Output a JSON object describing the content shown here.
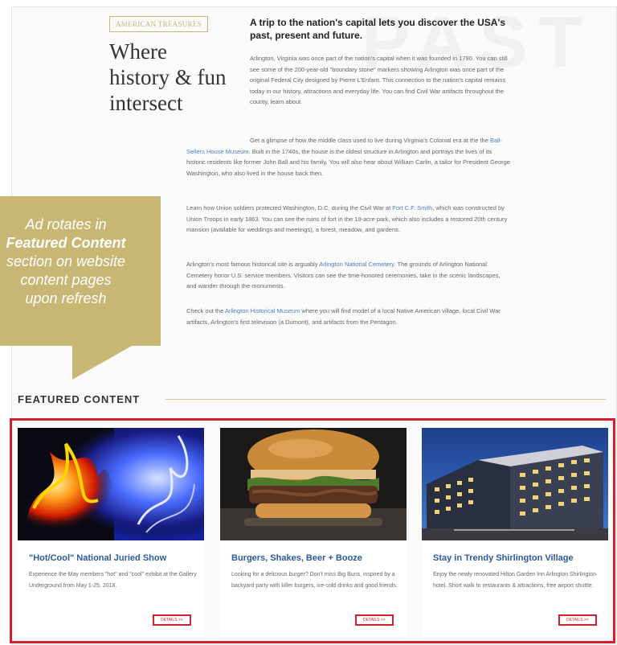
{
  "article": {
    "badge": "AMERICAN TREASURES",
    "headline": "Where history & fun intersect",
    "watermark": "PAST",
    "title": "A trip to the nation's capital lets you discover the USA's past, present and future.",
    "p1": "Arlington, Virginia was once part of the nation's capital when it was founded in 1790. You can still see some of the 200-year-old \"boundary stone\" markers showing Arlington was once part of the original Federal City designed by Pierre L'Enfant. This connection to the nation's capital remains today in our history, attractions and everyday life. You can find Civil War artifacts throughout the county, learn about",
    "p2_before": "Get a glimpse of how the middle class used to live during Virginia's Colonial era at the the ",
    "p2_link": "Ball-Sellers House Museum",
    "p2_after": ". Built in the 1740s, the house is the oldest structure in Arlington and portrays the lives of its historic residents like former John Ball and his family. You will also hear about William Carlin, a tailor for President George Washington, who also lived in the house back then.",
    "p3_before": "Learn how Union soldiers protected Washington, D.C. during the Civil War at ",
    "p3_link": "Fort C.F. Smith",
    "p3_after": ", which was constructed by Union Troops in early 1863. You can see the ruins of fort in the 19-acre park, which also includes a restored 20th century mansion (available for weddings and meetings), a forest, meadow, and gardens.",
    "p4_before": "Arlington's most famous historical site is arguably ",
    "p4_link": "Arlington National Cemetery",
    "p4_after": ". The grounds of Arlington National Cemetery honor U.S. service members. Visitors can see the time-honored ceremonies, take in the scenic landscapes, and wander through the monuments.",
    "p5_before": "Check out the ",
    "p5_link": "Arlington Historical Museum",
    "p5_after": " where you will find model of a local Native American village, local Civil War artifacts, Arlington's first television (a Dumont), and artifacts from the Pentagon."
  },
  "callout": {
    "line1": "Ad rotates in",
    "line2": "Featured Content",
    "line3": "section on website",
    "line4": "content pages",
    "line5": "upon refresh"
  },
  "featured": {
    "heading": "FEATURED CONTENT",
    "cards": [
      {
        "title": "\"Hot/Cool\" National Juried Show",
        "desc": "Experience the May members \"hot\" and \"cool\" exhibit at the Gallery Underground from May 1-25, 2018.",
        "button": "DETAILS >>",
        "image": "fire-and-smoke-image"
      },
      {
        "title": "Burgers, Shakes, Beer + Booze",
        "desc": "Looking for a delicious burger? Don't miss Big Buns, inspired by a backyard party with killer burgers, ice-cold drinks and good friends.",
        "button": "DETAILS >>",
        "image": "burger-image"
      },
      {
        "title": "Stay in Trendy Shirlington Village",
        "desc": "Enjoy the newly renovated Hilton Garden Inn Arlington Shirlington hotel. Short walk to restaurants & attractions, free airport shuttle.",
        "button": "DETAILS >>",
        "image": "hotel-building-image"
      }
    ]
  },
  "colors": {
    "accent_gold": "#c8b774",
    "highlight_red": "#d3202e",
    "link_blue": "#4a7fc4",
    "card_title_blue": "#2b5a99"
  }
}
